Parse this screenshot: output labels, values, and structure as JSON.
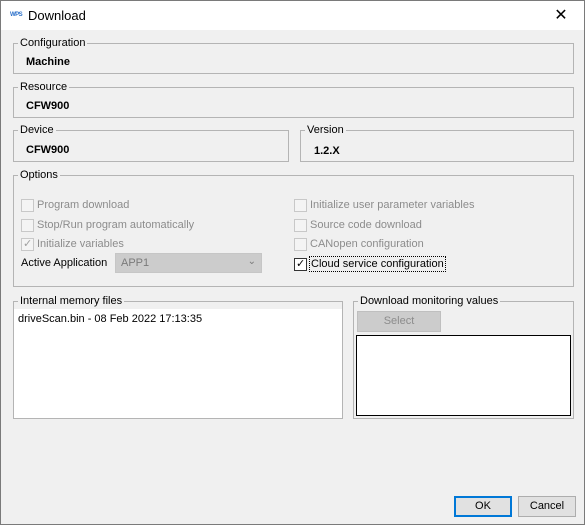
{
  "window": {
    "title": "Download",
    "app_icon": "WPS",
    "close_glyph": "✕"
  },
  "configuration": {
    "legend": "Configuration",
    "value": "Machine"
  },
  "resource": {
    "legend": "Resource",
    "value": "CFW900"
  },
  "device": {
    "legend": "Device",
    "value": "CFW900"
  },
  "version": {
    "legend": "Version",
    "value": "1.2.X"
  },
  "options": {
    "legend": "Options",
    "left": [
      {
        "label": "Program download",
        "checked": false
      },
      {
        "label": "Stop/Run program automatically",
        "checked": false
      },
      {
        "label": "Initialize variables",
        "checked": true
      }
    ],
    "right": [
      {
        "label": "Initialize user parameter variables",
        "checked": false
      },
      {
        "label": "Source code download",
        "checked": false
      },
      {
        "label": "CANopen configuration",
        "checked": false
      },
      {
        "label": "Cloud service configuration",
        "checked": true
      }
    ],
    "active_application_label": "Active Application",
    "active_application_value": "APP1"
  },
  "memory_files": {
    "legend": "Internal memory files",
    "items": [
      "driveScan.bin - 08 Feb 2022 17:13:35"
    ]
  },
  "monitoring": {
    "legend": "Download monitoring values",
    "select_label": "Select"
  },
  "footer": {
    "ok_label": "OK",
    "cancel_label": "Cancel"
  },
  "check_glyph": "✓"
}
